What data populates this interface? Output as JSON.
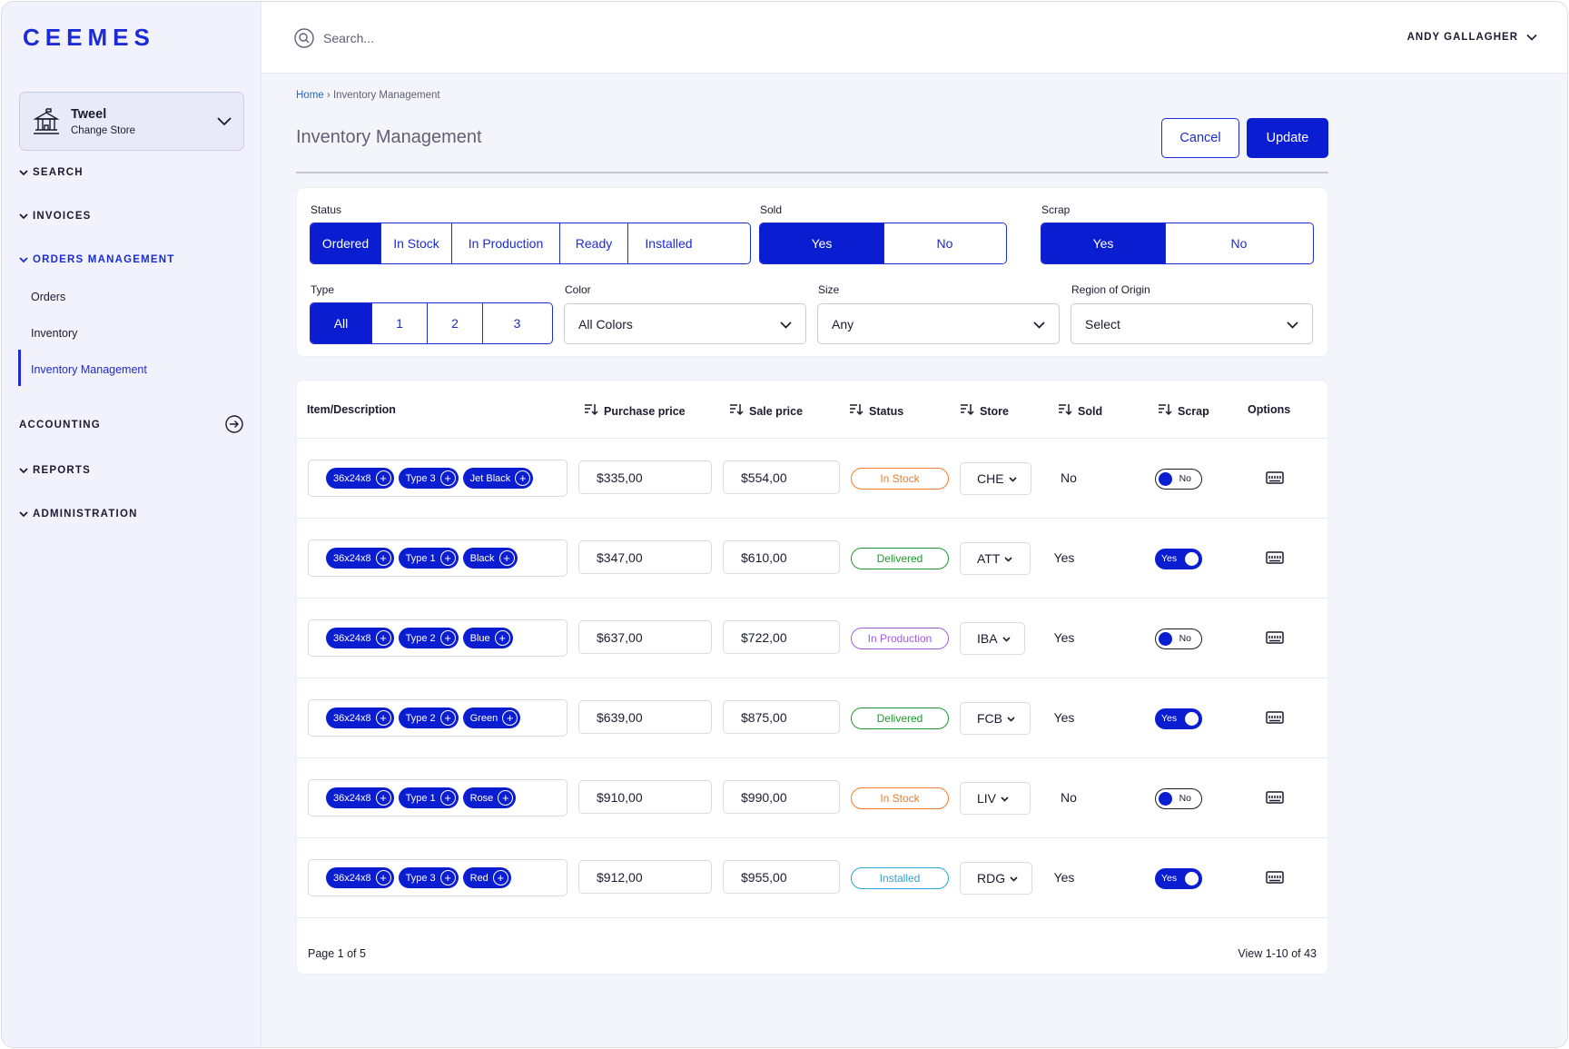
{
  "app": {
    "logo": "CEEMES"
  },
  "store": {
    "name": "Tweel",
    "sub": "Change Store"
  },
  "nav": {
    "search": "SEARCH",
    "invoices": "INVOICES",
    "orders_mgmt": "ORDERS MANAGEMENT",
    "orders": "Orders",
    "inventory": "Inventory",
    "inventory_mgmt": "Inventory Management",
    "accounting": "ACCOUNTING",
    "reports": "REPORTS",
    "administration": "ADMINISTRATION"
  },
  "header": {
    "search_placeholder": "Search...",
    "user": "ANDY GALLAGHER"
  },
  "breadcrumb": {
    "home": "Home",
    "sep": "›",
    "current": "Inventory Management"
  },
  "page": {
    "title": "Inventory Management",
    "cancel": "Cancel",
    "update": "Update"
  },
  "filters": {
    "status_label": "Status",
    "status_options": [
      "Ordered",
      "In Stock",
      "In Production",
      "Ready",
      "Installed"
    ],
    "status_selected": "Ordered",
    "sold_label": "Sold",
    "sold_options": [
      "Yes",
      "No"
    ],
    "sold_selected": "Yes",
    "scrap_label": "Scrap",
    "scrap_options": [
      "Yes",
      "No"
    ],
    "scrap_selected": "Yes",
    "type_label": "Type",
    "type_options": [
      "All",
      "1",
      "2",
      "3"
    ],
    "type_selected": "All",
    "color_label": "Color",
    "color_value": "All Colors",
    "size_label": "Size",
    "size_value": "Any",
    "region_label": "Region of Origin",
    "region_value": "Select"
  },
  "table": {
    "headers": {
      "item": "Item/Description",
      "purchase": "Purchase price",
      "sale": "Sale price",
      "status": "Status",
      "store": "Store",
      "sold": "Sold",
      "scrap": "Scrap",
      "options": "Options"
    },
    "rows": [
      {
        "size": "36x24x8",
        "type": "Type 3",
        "color": "Jet Black",
        "purchase": "$335,00",
        "sale": "$554,00",
        "status": "In Stock",
        "status_color": "#f07c2e",
        "store": "CHE",
        "sold": "No",
        "scrap": "No"
      },
      {
        "size": "36x24x8",
        "type": "Type 1",
        "color": "Black",
        "purchase": "$347,00",
        "sale": "$610,00",
        "status": "Delivered",
        "status_color": "#1e9a2c",
        "store": "ATT",
        "sold": "Yes",
        "scrap": "Yes"
      },
      {
        "size": "36x24x8",
        "type": "Type 2",
        "color": "Blue",
        "purchase": "$637,00",
        "sale": "$722,00",
        "status": "In Production",
        "status_color": "#a35be0",
        "store": "IBA",
        "sold": "Yes",
        "scrap": "No"
      },
      {
        "size": "36x24x8",
        "type": "Type 2",
        "color": "Green",
        "purchase": "$639,00",
        "sale": "$875,00",
        "status": "Delivered",
        "status_color": "#1e9a2c",
        "store": "FCB",
        "sold": "Yes",
        "scrap": "Yes"
      },
      {
        "size": "36x24x8",
        "type": "Type 1",
        "color": "Rose",
        "purchase": "$910,00",
        "sale": "$990,00",
        "status": "In Stock",
        "status_color": "#f07c2e",
        "store": "LIV",
        "sold": "No",
        "scrap": "No"
      },
      {
        "size": "36x24x8",
        "type": "Type 3",
        "color": "Red",
        "purchase": "$912,00",
        "sale": "$955,00",
        "status": "Installed",
        "status_color": "#2aa3d8",
        "store": "RDG",
        "sold": "Yes",
        "scrap": "Yes"
      }
    ],
    "pagination": "Page 1 of 5",
    "view": "View 1-10 of 43"
  },
  "colors": {
    "primary": "#0b1dd0",
    "accent": "#1b2bd6"
  }
}
